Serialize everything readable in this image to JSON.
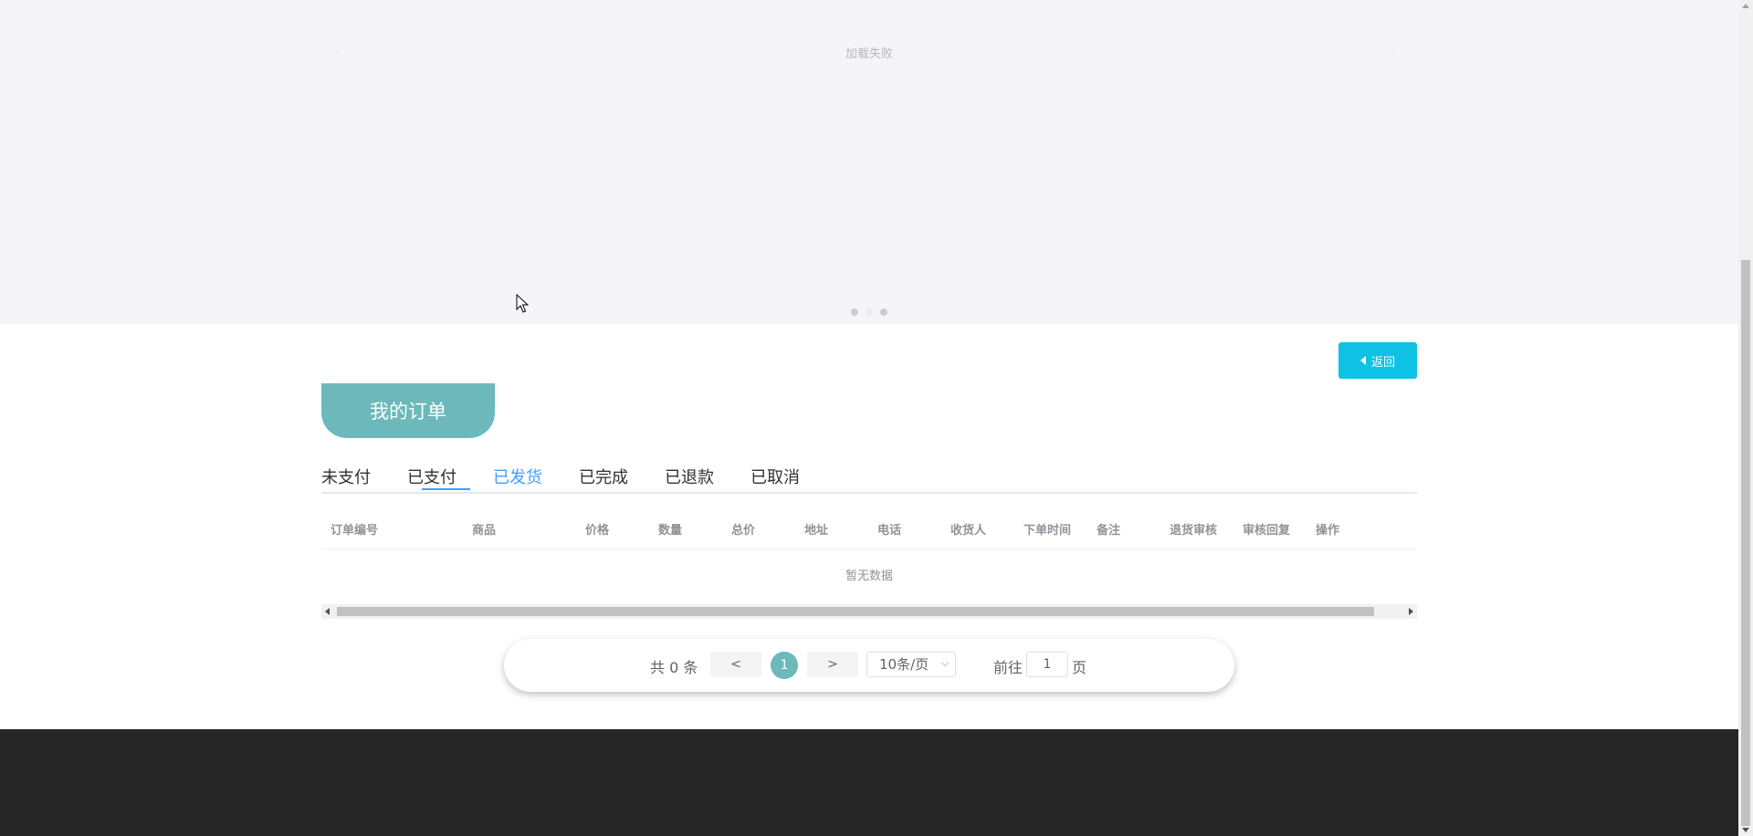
{
  "carousel": {
    "load_failed_text": "加载失败",
    "prev_arrow": "‹",
    "next_arrow": "›",
    "dots": 3,
    "active_dot": 1
  },
  "back_button": {
    "label": "返回",
    "icon": "caret-left-icon"
  },
  "page_title": "我的订单",
  "tabs": [
    {
      "label": "未支付"
    },
    {
      "label": "已支付"
    },
    {
      "label": "已发货"
    },
    {
      "label": "已完成"
    },
    {
      "label": "已退款"
    },
    {
      "label": "已取消"
    }
  ],
  "active_tab": "已发货",
  "table": {
    "columns": [
      "订单编号",
      "商品",
      "价格",
      "数量",
      "总价",
      "地址",
      "电话",
      "收货人",
      "下单时间",
      "备注",
      "退货审核",
      "审核回复",
      "操作"
    ],
    "empty_text": "暂无数据"
  },
  "pagination": {
    "total_text": "共 0 条",
    "prev": "<",
    "next": ">",
    "current_page": "1",
    "page_size": "10条/页",
    "goto_label": "前往",
    "goto_value": "1",
    "page_suffix": "页"
  },
  "colors": {
    "accent_teal": "#6cb8bb",
    "back_button": "#0fc2e4",
    "active_tab": "#409eff",
    "footer": "#262626"
  }
}
